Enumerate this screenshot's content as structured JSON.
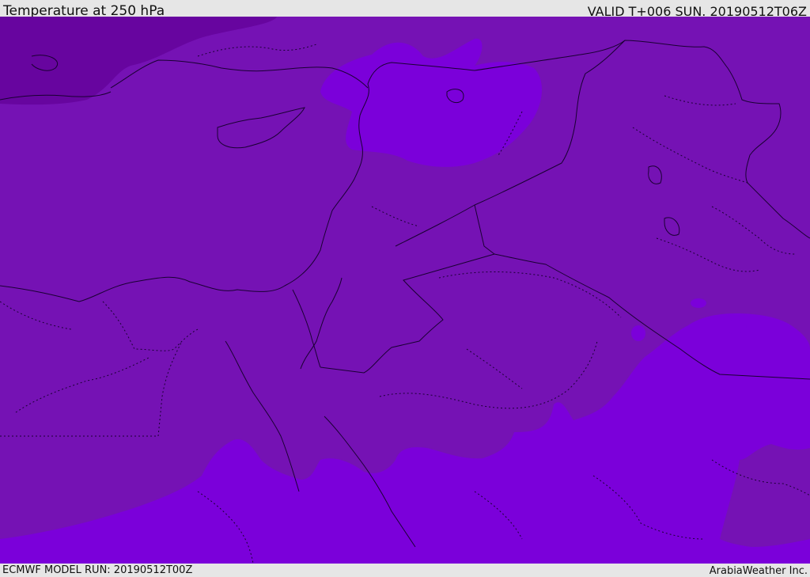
{
  "header": {
    "title": "Temperature at 250 hPa",
    "valid": "VALID T+006 SUN. 20190512T06Z"
  },
  "footer": {
    "model_run": "ECMWF MODEL RUN: 20190512T00Z",
    "credit": "ArabiaWeather Inc."
  },
  "map": {
    "colors": {
      "base": "#7512b4",
      "warm": "#7b00da",
      "cold": "#67059f",
      "border": "#1a0033"
    }
  }
}
